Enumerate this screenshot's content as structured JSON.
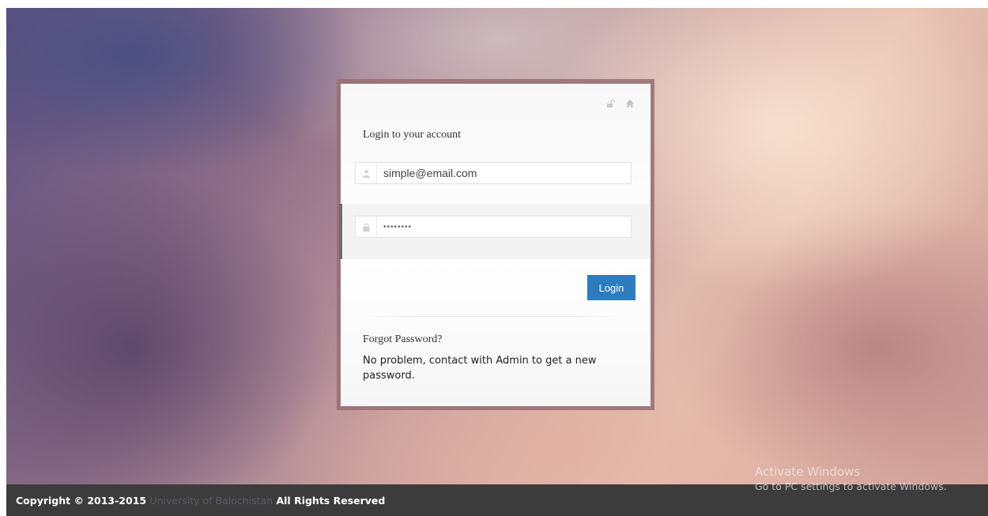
{
  "login": {
    "title": "Login to your account",
    "email_value": "simple@email.com",
    "password_value": "••••••••",
    "login_button": "Login",
    "top_icons": [
      "unlock-icon",
      "home-icon"
    ]
  },
  "forgot": {
    "title": "Forgot Password?",
    "text": "No problem, contact with Admin to get a new password."
  },
  "footer": {
    "prefix": "Copyright © 2013-2015 ",
    "university": "University of Balochistan",
    "suffix": " All Rights Reserved"
  },
  "watermark": {
    "line1": "Activate Windows",
    "line2": "Go to PC settings to activate Windows."
  },
  "colors": {
    "accent_button": "#2d7cc0",
    "footer_bg": "#3c3c3c"
  }
}
